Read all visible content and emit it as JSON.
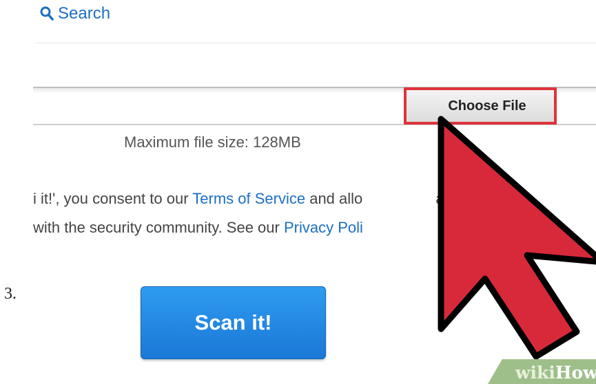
{
  "header": {
    "search_label": "Search"
  },
  "upload": {
    "choose_file_label": "Choose File",
    "max_size_text": "Maximum file size: 128MB"
  },
  "consent": {
    "line1_prefix": "i it!', you consent to our ",
    "terms_link": "Terms of Service",
    "line1_middle": " and allo",
    "line1_suffix": "al to",
    "line2_prefix": "with the security community. See our ",
    "privacy_link": "Privacy Poli"
  },
  "step": {
    "number": "3."
  },
  "scan": {
    "button_label": "Scan it!"
  },
  "watermark": {
    "prefix": "wiki",
    "suffix": "How"
  },
  "colors": {
    "link_blue": "#1c6fc2",
    "highlight_red": "#e0333b",
    "cursor_red": "#d8293a",
    "button_blue": "#1a78d6"
  },
  "icons": {
    "search": "magnifier",
    "cursor": "arrow-pointer"
  }
}
